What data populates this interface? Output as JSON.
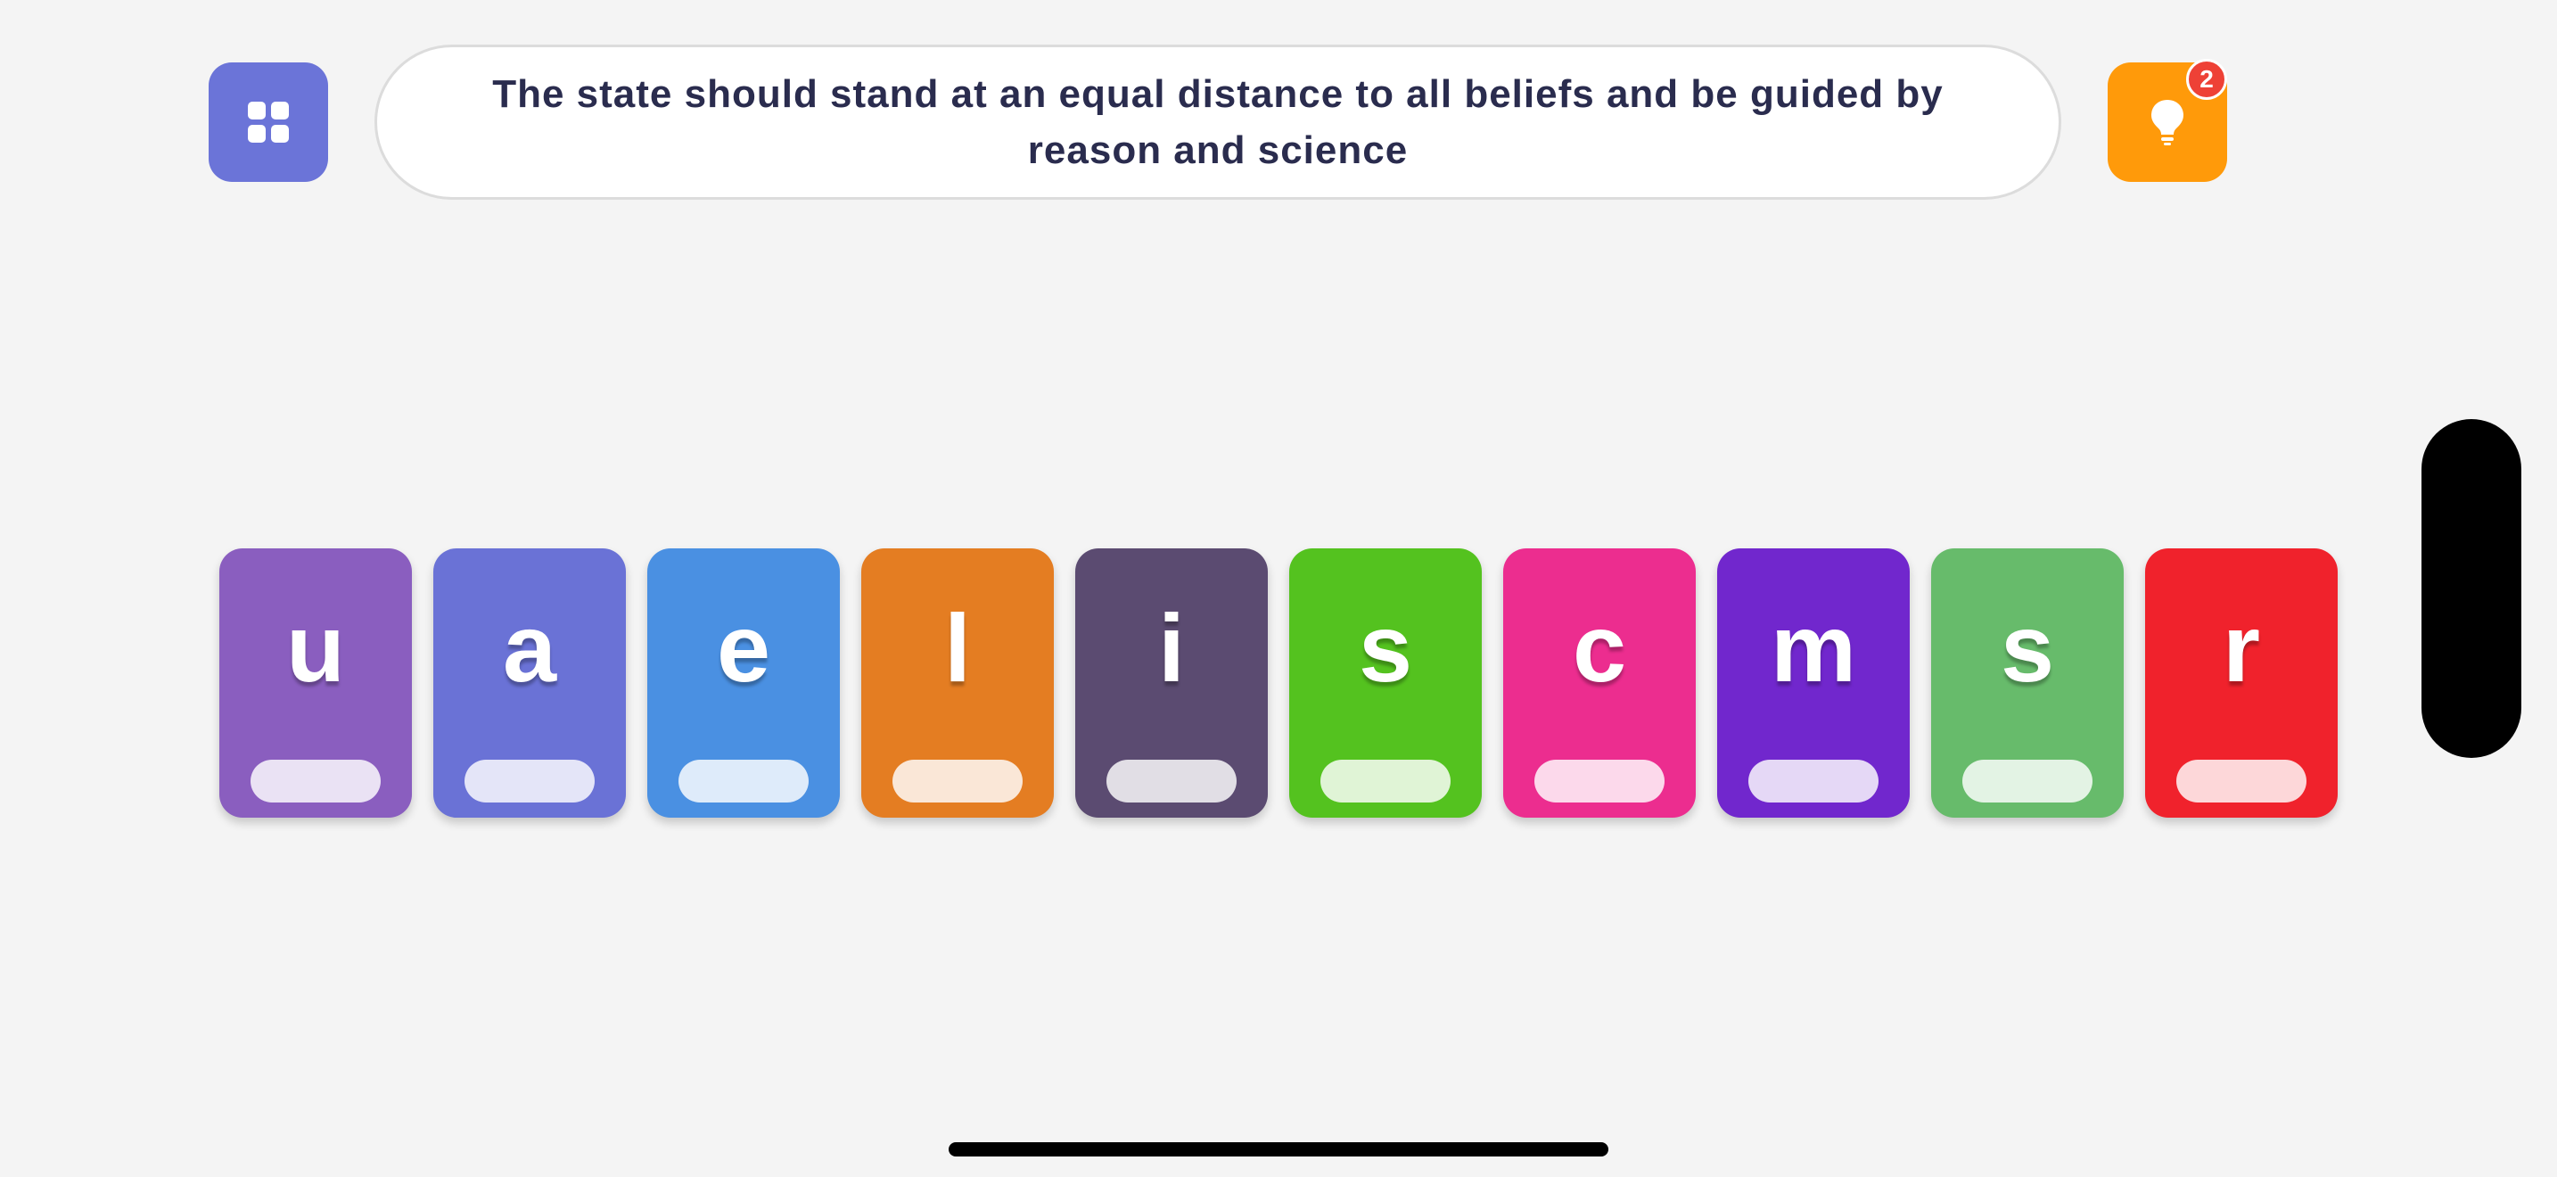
{
  "header": {
    "menu_icon": "grid-menu-icon",
    "clue": "The state should stand at an equal distance to all beliefs and be guided by reason and science",
    "hint_icon": "lightbulb-icon",
    "hint_count": "2"
  },
  "tiles": [
    {
      "letter": "u",
      "color": "#8a5ebf"
    },
    {
      "letter": "a",
      "color": "#6a72d6"
    },
    {
      "letter": "e",
      "color": "#4a90e2"
    },
    {
      "letter": "l",
      "color": "#e47d22"
    },
    {
      "letter": "i",
      "color": "#5b4b71"
    },
    {
      "letter": "s",
      "color": "#54c21f"
    },
    {
      "letter": "c",
      "color": "#ec2d8f"
    },
    {
      "letter": "m",
      "color": "#7127cd"
    },
    {
      "letter": "s",
      "color": "#67bb6b"
    },
    {
      "letter": "r",
      "color": "#f0222c"
    }
  ],
  "colors": {
    "background": "#f4f4f4",
    "menu_button": "#6b74d8",
    "hint_button": "#ff9a0a",
    "hint_badge": "#ee4136",
    "clue_text": "#2a2c4e"
  }
}
